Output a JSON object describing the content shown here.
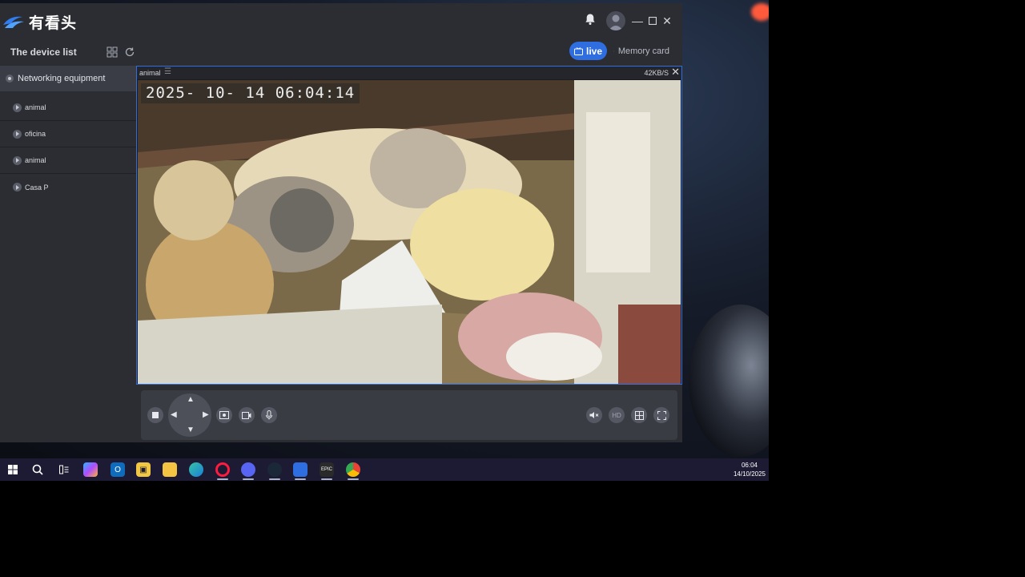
{
  "app": {
    "title": "有看头",
    "device_list_label": "The device list",
    "tabs": {
      "live": "live",
      "memory": "Memory card"
    }
  },
  "sidebar": {
    "group": "Networking equipment",
    "devices": [
      {
        "label": "animal"
      },
      {
        "label": "oficina"
      },
      {
        "label": "animal"
      },
      {
        "label": "Casa P"
      }
    ]
  },
  "video": {
    "channel_name": "animal",
    "bitrate": "42KB/S",
    "osd_timestamp": "2025- 10- 14   06:04:14"
  },
  "controls": {
    "quality_label": "HD"
  },
  "taskbar": {
    "time": "06:04",
    "date": "14/10/2025"
  },
  "colors": {
    "accent": "#2f6ee0",
    "window_bg": "#2b2d33",
    "taskbar_bg": "#1d1b33"
  }
}
